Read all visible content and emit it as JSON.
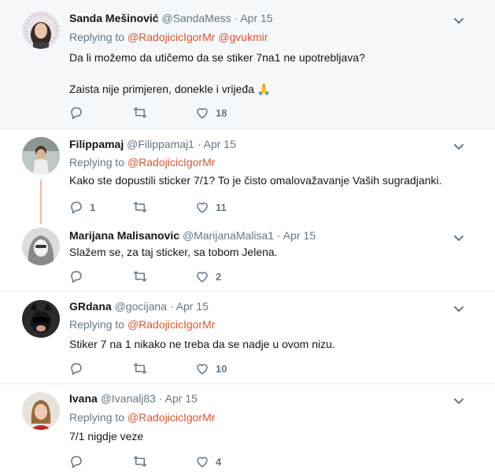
{
  "tweets": [
    {
      "name": "Sanda Mešinović",
      "handle": "@SandaMess",
      "time": "Apr 15",
      "replying_label": "Replying to",
      "replying_to": [
        "@RadojicicIgorMr",
        "@gvukmir"
      ],
      "lines": [
        "Da li možemo da utičemo da se stiker 7na1 ne upotrebljava?",
        "",
        "Zaista nije primjeren, donekle i vrijeđa 🙏"
      ],
      "replies": "",
      "retweets": "",
      "likes": "18"
    },
    {
      "name": "Filippamaj",
      "handle": "@Filippamaj1",
      "time": "Apr 15",
      "replying_label": "Replying to",
      "replying_to": [
        "@RadojicicIgorMr"
      ],
      "lines": [
        "Kako ste dopustili sticker 7/1? To je čisto omalovažavanje Vaših sugradjanki."
      ],
      "replies": "1",
      "retweets": "",
      "likes": "11"
    },
    {
      "name": "Marijana Malisanovic",
      "handle": "@MarijanaMalisa1",
      "time": "Apr 15",
      "replying_label": "",
      "replying_to": [],
      "lines": [
        "Slažem se, za taj sticker, sa tobom Jelena."
      ],
      "replies": "",
      "retweets": "",
      "likes": "2"
    },
    {
      "name": "GRdana",
      "handle": "@gocijana",
      "time": "Apr 15",
      "replying_label": "Replying to",
      "replying_to": [
        "@RadojicicIgorMr"
      ],
      "lines": [
        "Stiker 7 na 1 nikako ne treba da se nadje u ovom nizu."
      ],
      "replies": "",
      "retweets": "",
      "likes": "10"
    },
    {
      "name": "Ivana",
      "handle": "@Ivanalj83",
      "time": "Apr 15",
      "replying_label": "Replying to",
      "replying_to": [
        "@RadojicicIgorMr"
      ],
      "lines": [
        "7/1 nigdje veze"
      ],
      "replies": "",
      "retweets": "",
      "likes": "4"
    }
  ],
  "colors": {
    "link": "#e0552f",
    "muted": "#657786",
    "thread_line": "#f7b59f",
    "highlight_bg": "#f5f8fa"
  },
  "icons": {
    "reply": "reply-icon",
    "retweet": "retweet-icon",
    "like": "heart-icon",
    "menu": "chevron-down-icon"
  }
}
